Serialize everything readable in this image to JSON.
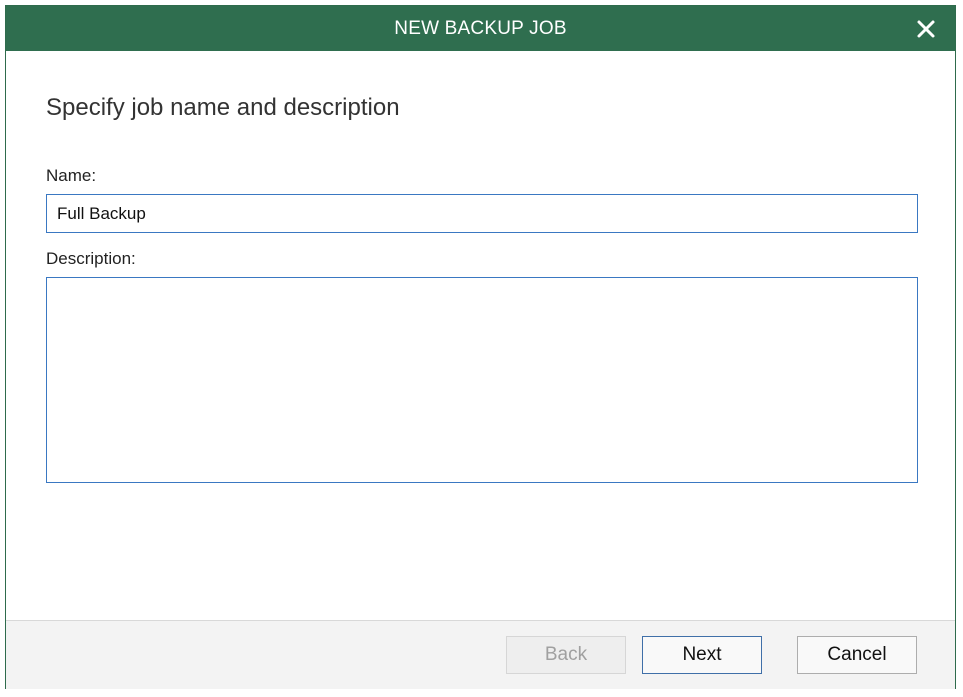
{
  "window": {
    "title": "NEW BACKUP JOB",
    "close_icon": "close-icon"
  },
  "page": {
    "heading": "Specify job name and description"
  },
  "form": {
    "name_label": "Name:",
    "name_value": "Full Backup",
    "description_label": "Description:",
    "description_value": ""
  },
  "footer": {
    "back_label": "Back",
    "back_enabled": false,
    "next_label": "Next",
    "cancel_label": "Cancel"
  },
  "colors": {
    "titlebar": "#2f6e4f",
    "input_border": "#3a78c2",
    "disabled_text": "#a0a0a0"
  }
}
